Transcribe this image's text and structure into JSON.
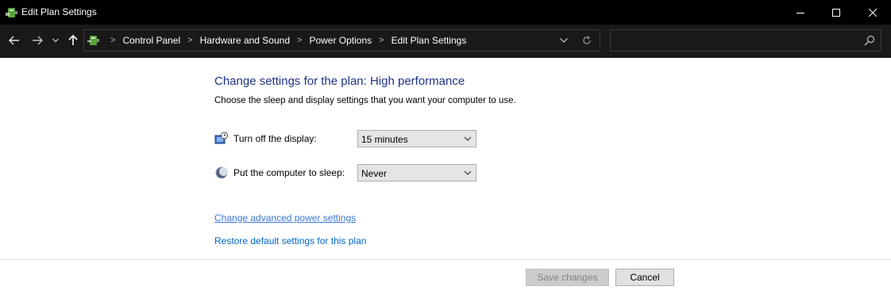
{
  "window": {
    "title": "Edit Plan Settings",
    "controls": {
      "minimize_icon": "minimize-icon",
      "maximize_icon": "maximize-icon",
      "close_icon": "close-icon"
    }
  },
  "nav": {
    "back_icon": "arrow-left-icon",
    "forward_icon": "arrow-right-icon",
    "recent_icon": "chevron-down-icon",
    "up_icon": "arrow-up-icon",
    "breadcrumbs": [
      "Control Panel",
      "Hardware and Sound",
      "Power Options",
      "Edit Plan Settings"
    ],
    "dropdown_icon": "chevron-down-icon",
    "refresh_icon": "refresh-icon",
    "search_placeholder": "",
    "search_icon": "search-icon"
  },
  "main": {
    "heading": "Change settings for the plan: High performance",
    "description": "Choose the sleep and display settings that you want your computer to use.",
    "settings": [
      {
        "label": "Turn off the display:",
        "value": "15 minutes",
        "icon": "monitor-clock-icon"
      },
      {
        "label": "Put the computer to sleep:",
        "value": "Never",
        "icon": "moon-icon"
      }
    ],
    "links": {
      "advanced": "Change advanced power settings",
      "restore": "Restore default settings for this plan"
    }
  },
  "footer": {
    "save_label": "Save changes",
    "cancel_label": "Cancel"
  },
  "colors": {
    "heading": "#1e3287",
    "link": "#0066cc",
    "titlebar": "#000000",
    "navbar": "#191919"
  }
}
